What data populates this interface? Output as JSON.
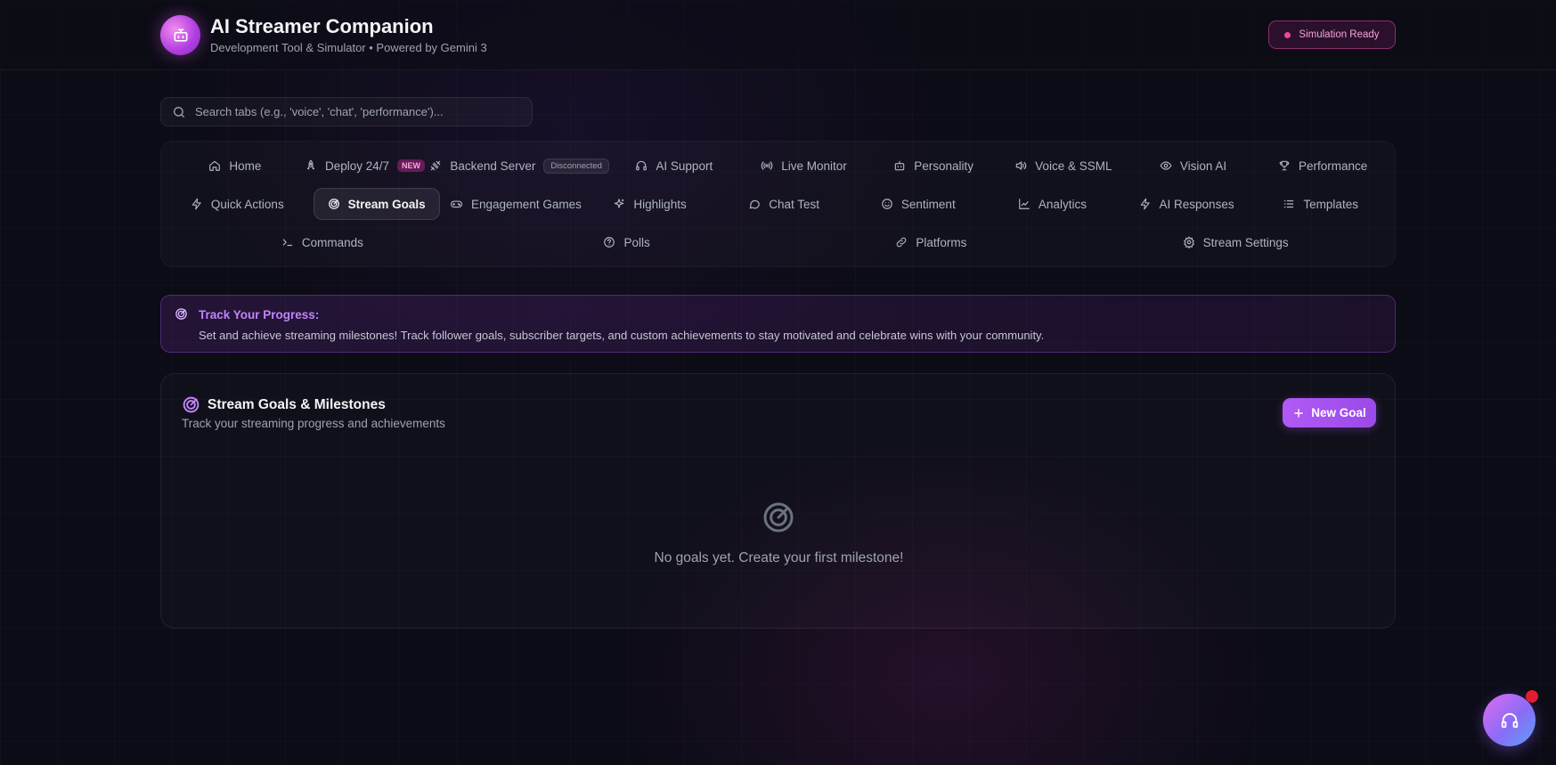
{
  "header": {
    "title": "AI Streamer Companion",
    "subtitle": "Development Tool & Simulator • Powered by Gemini 3",
    "status": "Simulation Ready",
    "logo_icon": "robot-icon"
  },
  "search": {
    "placeholder": "Search tabs (e.g., 'voice', 'chat', 'performance')...",
    "value": ""
  },
  "tabs": {
    "row1": [
      {
        "label": "Home",
        "icon": "home-icon"
      },
      {
        "label": "Deploy 24/7",
        "icon": "rocket-icon",
        "badge": "NEW"
      },
      {
        "label": "Backend Server",
        "icon": "plug-icon",
        "badge": "Disconnected"
      },
      {
        "label": "AI Support",
        "icon": "headset-icon"
      },
      {
        "label": "Live Monitor",
        "icon": "radio-icon"
      },
      {
        "label": "Personality",
        "icon": "bot-icon"
      },
      {
        "label": "Voice & SSML",
        "icon": "speaker-icon"
      },
      {
        "label": "Vision AI",
        "icon": "eye-icon"
      },
      {
        "label": "Performance",
        "icon": "trophy-icon"
      }
    ],
    "row2": [
      {
        "label": "Quick Actions",
        "icon": "lightning-icon"
      },
      {
        "label": "Stream Goals",
        "icon": "target-icon",
        "active": true
      },
      {
        "label": "Engagement Games",
        "icon": "gamepad-icon"
      },
      {
        "label": "Highlights",
        "icon": "sparkles-icon"
      },
      {
        "label": "Chat Test",
        "icon": "chat-bubble-icon"
      },
      {
        "label": "Sentiment",
        "icon": "smile-icon"
      },
      {
        "label": "Analytics",
        "icon": "chart-line-icon"
      },
      {
        "label": "AI Responses",
        "icon": "lightning-icon"
      },
      {
        "label": "Templates",
        "icon": "list-icon"
      }
    ],
    "row3": [
      {
        "label": "Commands",
        "icon": "terminal-icon"
      },
      {
        "label": "Polls",
        "icon": "help-circle-icon"
      },
      {
        "label": "Platforms",
        "icon": "link-icon"
      },
      {
        "label": "Stream Settings",
        "icon": "settings-icon"
      }
    ]
  },
  "banner": {
    "title": "Track Your Progress:",
    "text": "Set and achieve streaming milestones! Track follower goals, subscriber targets, and custom achievements to stay motivated and celebrate wins with your community."
  },
  "goals": {
    "title": "Stream Goals & Milestones",
    "subtitle": "Track your streaming progress and achievements",
    "new_button": "New Goal",
    "empty_text": "No goals yet. Create your first milestone!"
  },
  "colors": {
    "accent": "#a855f7",
    "pink": "#ec4899",
    "background": "#0c0c16"
  }
}
